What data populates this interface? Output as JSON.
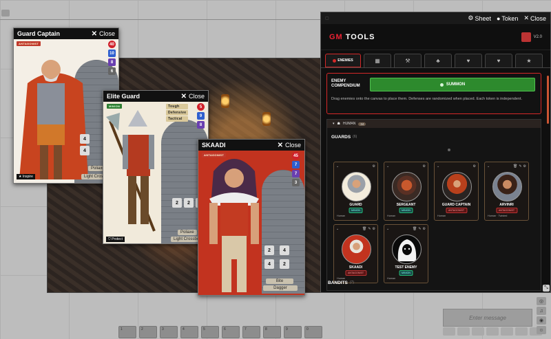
{
  "cards": {
    "guard_captain": {
      "title": "Guard Captain",
      "close": "Close",
      "type": "ANTAGONIST",
      "hp": "40",
      "stats": [
        "10",
        "8",
        "6"
      ],
      "dice": [
        "4",
        "4"
      ],
      "buttons": [
        "Poliaxe",
        "Light Crossbo"
      ],
      "foot": "Inspire"
    },
    "elite_guard": {
      "title": "Elite Guard",
      "close": "Close",
      "type": "MINION",
      "traits": [
        "Tough",
        "Defensive",
        "Tactical"
      ],
      "hp": "5",
      "stats": [
        "9",
        "8"
      ],
      "dice": [
        "2",
        "2",
        "2"
      ],
      "buttons": [
        "Poliaxe",
        "Light Crossbo"
      ],
      "foot": "Protect"
    },
    "skaadi": {
      "title": "SKAADI",
      "close": "Close",
      "type": "ANTAGONIST",
      "hp": "45",
      "stats": [
        "7",
        "7",
        "3"
      ],
      "dice": [
        "2",
        "4",
        "4",
        "2"
      ],
      "buttons": [
        "Bite",
        "Dagger"
      ]
    }
  },
  "gm": {
    "sheet": "Sheet",
    "token": "Token",
    "close": "Close",
    "title_gm": "GM",
    "title_rest": " TOOLS",
    "version": "V2.0",
    "tab_enemies": "ENEMIES",
    "compendium_title": [
      "ENEMY",
      "COMPENDIUM"
    ],
    "summon": "SUMMON",
    "compendium_desc": "Drag enemies onto the canvas to place them. Defenses are randomized when placed. Each token is independent.",
    "group": "HUMAN",
    "group_count": "34",
    "guards_label": "GUARDS",
    "guards_count": "(6)",
    "bandits_label": "BANDITS",
    "bandits_count": "(7)",
    "enemies": [
      {
        "name": "GUARD",
        "type": "MINION",
        "race": "Human"
      },
      {
        "name": "SERGEANT",
        "type": "MINION",
        "race": "Human"
      },
      {
        "name": "GUARD CAPTAIN",
        "type": "ANTAGONIST",
        "race": "Human"
      },
      {
        "name": "ARVINRI",
        "type": "ANTAGONIST",
        "race": "Human · Twisted"
      },
      {
        "name": "SKAADI",
        "type": "ANTAGONIST",
        "race": "Human"
      },
      {
        "name": "TEST ENEMY",
        "type": "MINION",
        "race": "Human"
      }
    ]
  },
  "chat": {
    "placeholder": "Enter message"
  },
  "hotbar": [
    "1",
    "2",
    "3",
    "4",
    "5",
    "6",
    "7",
    "8",
    "9",
    "0"
  ]
}
